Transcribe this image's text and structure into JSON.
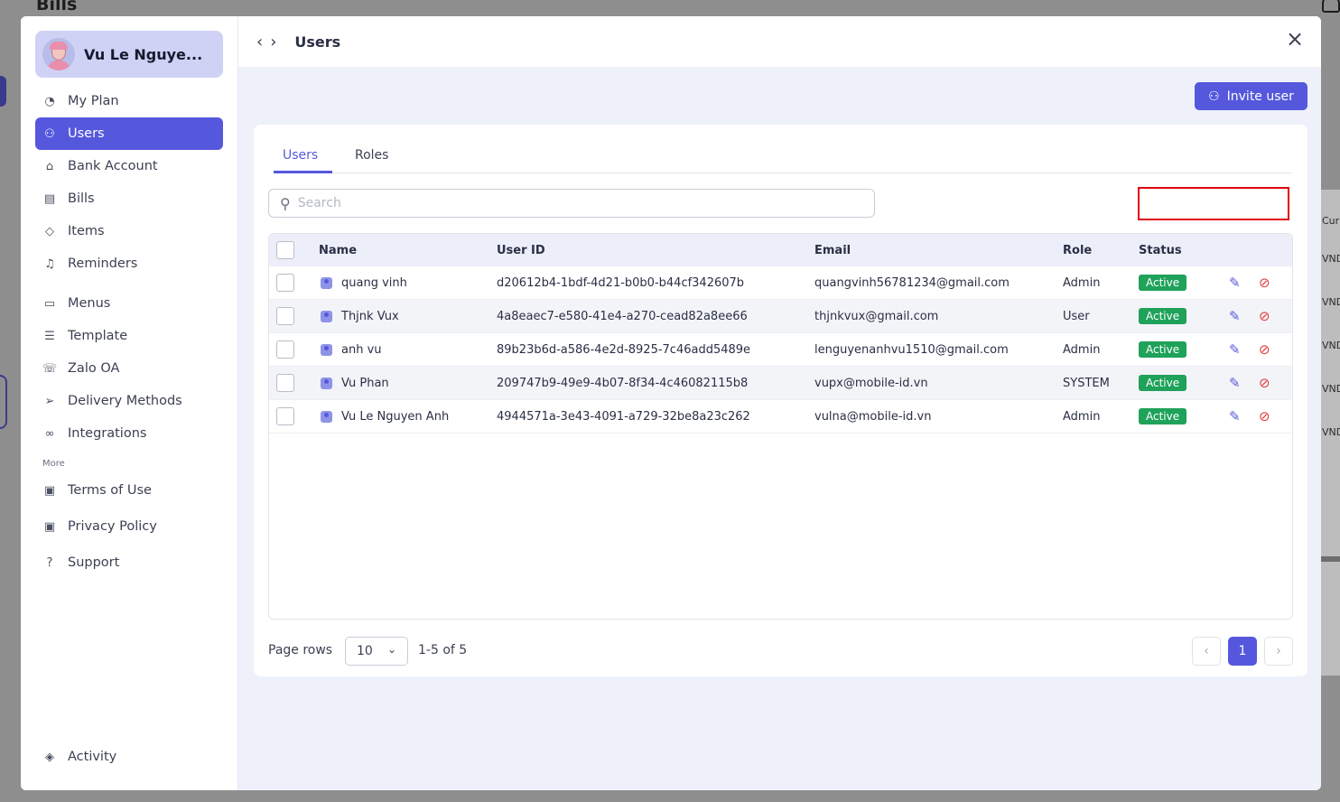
{
  "background": {
    "title": "Bills",
    "right_labels": [
      "Cur",
      "VND",
      "VND",
      "VND",
      "VND",
      "VND"
    ]
  },
  "profile": {
    "name": "Vu Le Nguye..."
  },
  "sidebar": {
    "items": [
      {
        "label": "My Plan",
        "icon": "pie-chart-icon"
      },
      {
        "label": "Users",
        "icon": "users-icon",
        "active": true
      },
      {
        "label": "Bank Account",
        "icon": "bank-icon"
      },
      {
        "label": "Bills",
        "icon": "bill-icon"
      },
      {
        "label": "Items",
        "icon": "box-icon"
      },
      {
        "label": "Reminders",
        "icon": "bell-icon"
      },
      {
        "label": "Menus",
        "icon": "menu-icon"
      },
      {
        "label": "Template",
        "icon": "template-icon"
      },
      {
        "label": "Zalo OA",
        "icon": "chat-icon"
      },
      {
        "label": "Delivery Methods",
        "icon": "send-icon"
      },
      {
        "label": "Integrations",
        "icon": "link-icon"
      }
    ],
    "section_more": "More",
    "more_items": [
      {
        "label": "Terms of Use",
        "icon": "clipboard-icon"
      },
      {
        "label": "Privacy Policy",
        "icon": "clipboard-icon"
      },
      {
        "label": "Support",
        "icon": "help-icon"
      }
    ],
    "bottom_item": {
      "label": "Activity",
      "icon": "layers-icon"
    }
  },
  "header": {
    "title": "Users",
    "back": "‹",
    "forward": "›",
    "close": "×"
  },
  "invite_button": {
    "label": "Invite user"
  },
  "tabs": [
    {
      "label": "Users",
      "active": true
    },
    {
      "label": "Roles"
    }
  ],
  "search": {
    "placeholder": "Search",
    "value": ""
  },
  "table": {
    "columns": [
      "Name",
      "User ID",
      "Email",
      "Role",
      "Status"
    ],
    "rows": [
      {
        "name": "quang vinh",
        "id": "d20612b4-1bdf-4d21-b0b0-b44cf342607b",
        "email": "quangvinh56781234@gmail.com",
        "role": "Admin",
        "status": "Active"
      },
      {
        "name": "Thjnk Vux",
        "id": "4a8eaec7-e580-41e4-a270-cead82a8ee66",
        "email": "thjnkvux@gmail.com",
        "role": "User",
        "status": "Active"
      },
      {
        "name": "anh vu",
        "id": "89b23b6d-a586-4e2d-8925-7c46add5489e",
        "email": "lenguyenanhvu1510@gmail.com",
        "role": "Admin",
        "status": "Active"
      },
      {
        "name": "Vu Phan",
        "id": "209747b9-49e9-4b07-8f34-4c46082115b8",
        "email": "vupx@mobile-id.vn",
        "role": "SYSTEM",
        "status": "Active"
      },
      {
        "name": "Vu Le Nguyen Anh",
        "id": "4944571a-3e43-4091-a729-32be8a23c262",
        "email": "vulna@mobile-id.vn",
        "role": "Admin",
        "status": "Active"
      }
    ]
  },
  "pagination": {
    "label": "Page rows",
    "page_size": "10",
    "range": "1-5 of 5",
    "current_page": "1"
  },
  "colors": {
    "accent": "#5558dd",
    "active_badge": "#1fa25a",
    "block": "#e23b3b",
    "highlight_box": "#e0000b"
  }
}
